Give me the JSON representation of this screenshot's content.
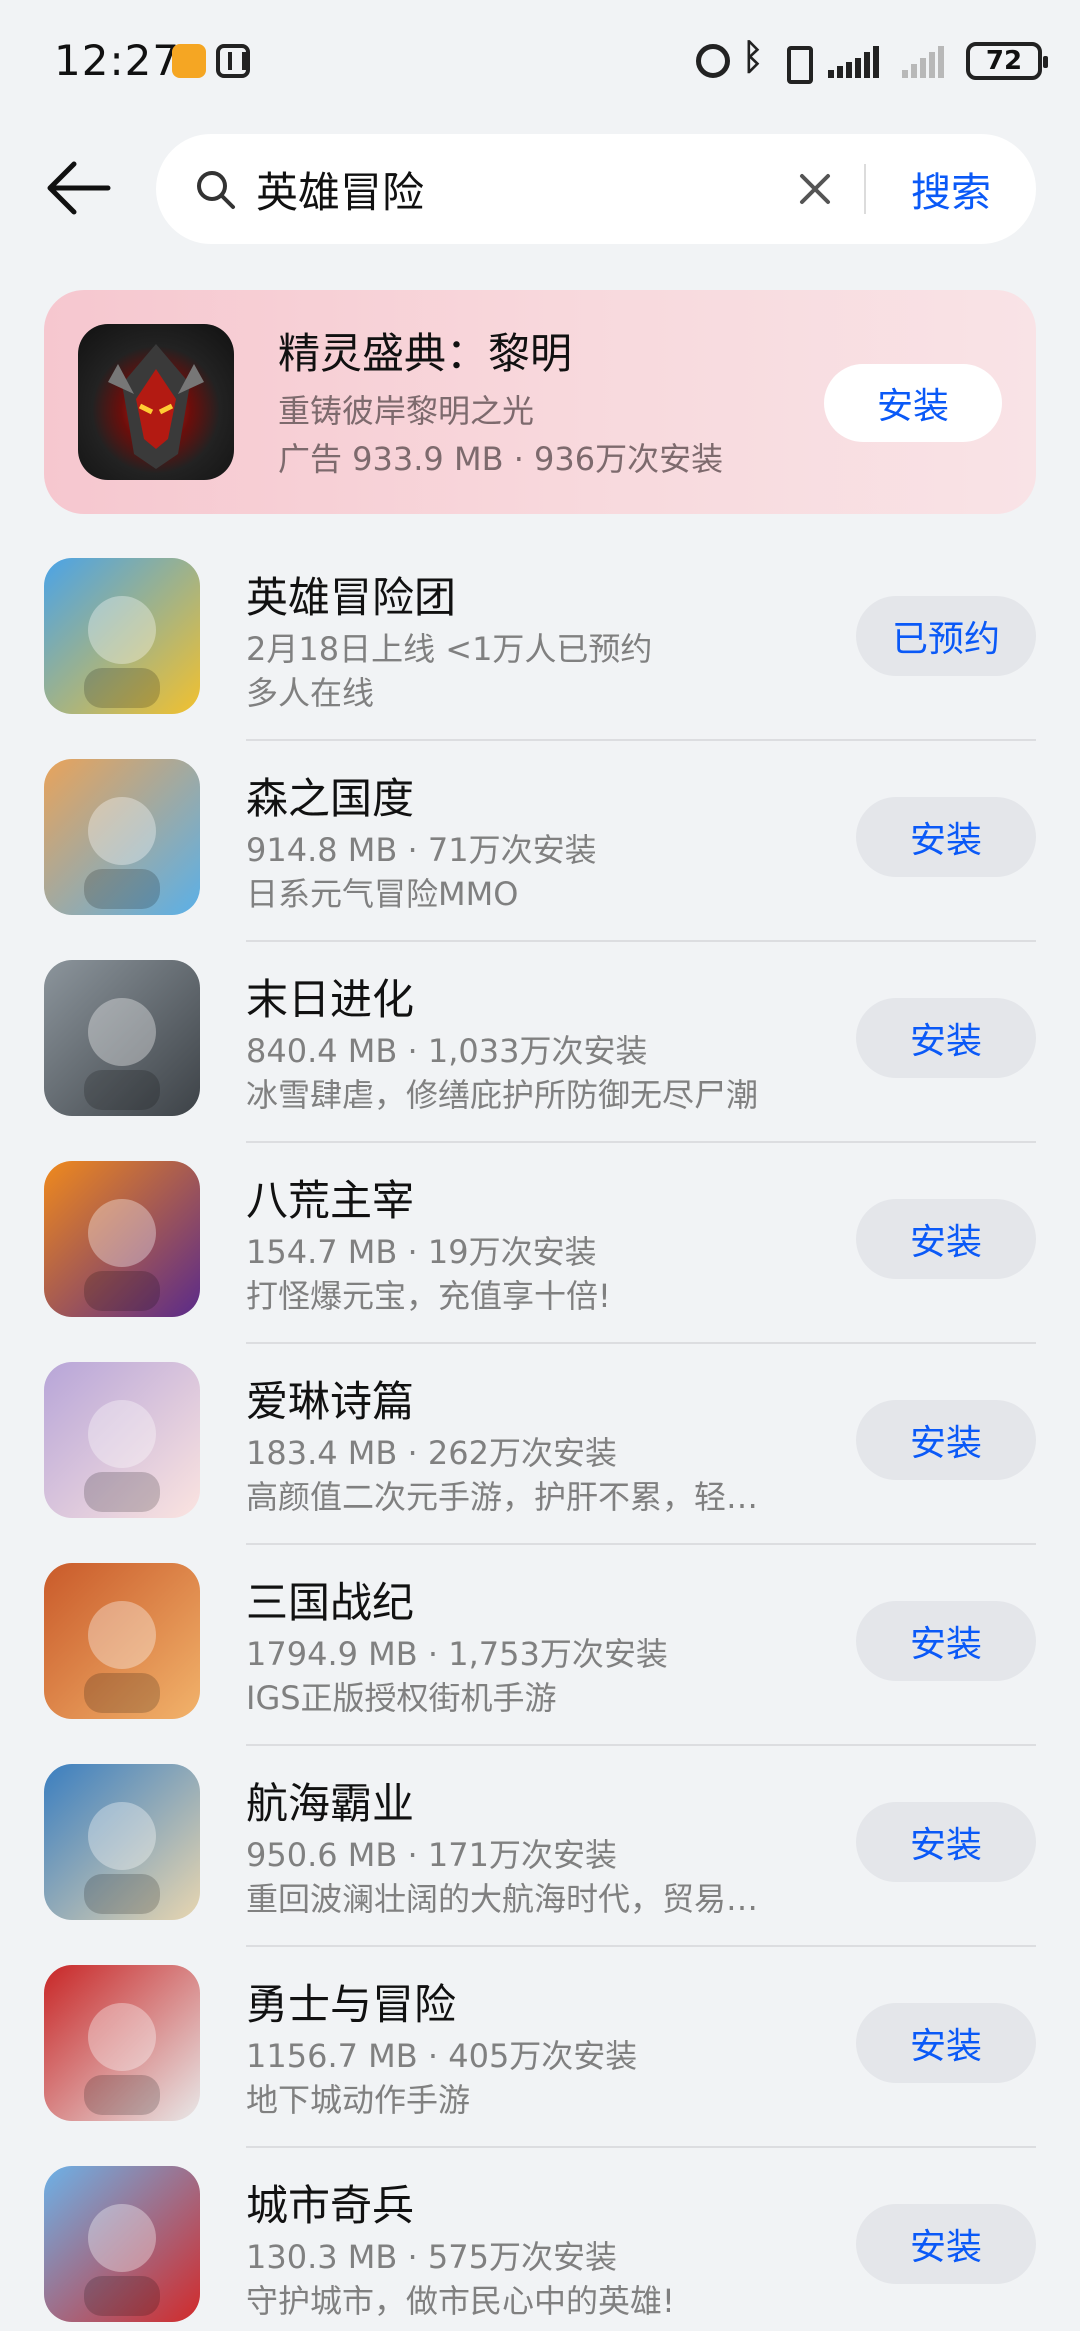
{
  "status_bar": {
    "time": "12:27",
    "battery": "72",
    "icons": [
      "app-notification-icon",
      "nfc-icon",
      "alarm-icon",
      "bluetooth-icon",
      "vibrate-icon",
      "signal-icon",
      "signal-no-sim-icon",
      "battery-icon"
    ]
  },
  "search": {
    "query": "英雄冒险",
    "button_label": "搜索"
  },
  "ad": {
    "title": "精灵盛典：黎明",
    "subtitle": "重铸彼岸黎明之光",
    "meta": "广告 933.9 MB · 936万次安装",
    "button_label": "安装"
  },
  "apps": [
    {
      "name": "英雄冒险团",
      "meta": "2月18日上线  <1万人已预约",
      "desc": "多人在线",
      "action": "已预约",
      "icon_colors": [
        "#4aa3e8",
        "#f2c12e"
      ]
    },
    {
      "name": "森之国度",
      "meta": "914.8 MB · 71万次安装",
      "desc": "日系元气冒险MMO",
      "action": "安装",
      "icon_colors": [
        "#e9a35a",
        "#5ab0e8"
      ]
    },
    {
      "name": "末日进化",
      "meta": "840.4 MB · 1,033万次安装",
      "desc": "冰雪肆虐，修缮庇护所防御无尽尸潮",
      "action": "安装",
      "icon_colors": [
        "#8c959c",
        "#3d4247"
      ]
    },
    {
      "name": "八荒主宰",
      "meta": "154.7 MB · 19万次安装",
      "desc": "打怪爆元宝，充值享十倍!",
      "action": "安装",
      "icon_colors": [
        "#f08a1c",
        "#5a2a8a"
      ]
    },
    {
      "name": "爱琳诗篇",
      "meta": "183.4 MB · 262万次安装",
      "desc": "高颜值二次元手游，护肝不累，轻…",
      "action": "安装",
      "icon_colors": [
        "#b7a5d8",
        "#fbe4e0"
      ]
    },
    {
      "name": "三国战纪",
      "meta": "1794.9 MB · 1,753万次安装",
      "desc": "IGS正版授权街机手游",
      "action": "安装",
      "icon_colors": [
        "#c95a2a",
        "#f2b36b"
      ]
    },
    {
      "name": "航海霸业",
      "meta": "950.6 MB · 171万次安装",
      "desc": "重回波澜壮阔的大航海时代，贸易…",
      "action": "安装",
      "icon_colors": [
        "#3a7ec0",
        "#e8d6b0"
      ]
    },
    {
      "name": "勇士与冒险",
      "meta": "1156.7 MB · 405万次安装",
      "desc": "地下城动作手游",
      "action": "安装",
      "icon_colors": [
        "#c82626",
        "#e8e8e8"
      ]
    },
    {
      "name": "城市奇兵",
      "meta": "130.3 MB · 575万次安装",
      "desc": "守护城市，做市民心中的英雄!",
      "action": "安装",
      "icon_colors": [
        "#6cb2e8",
        "#d22a2a"
      ]
    }
  ]
}
